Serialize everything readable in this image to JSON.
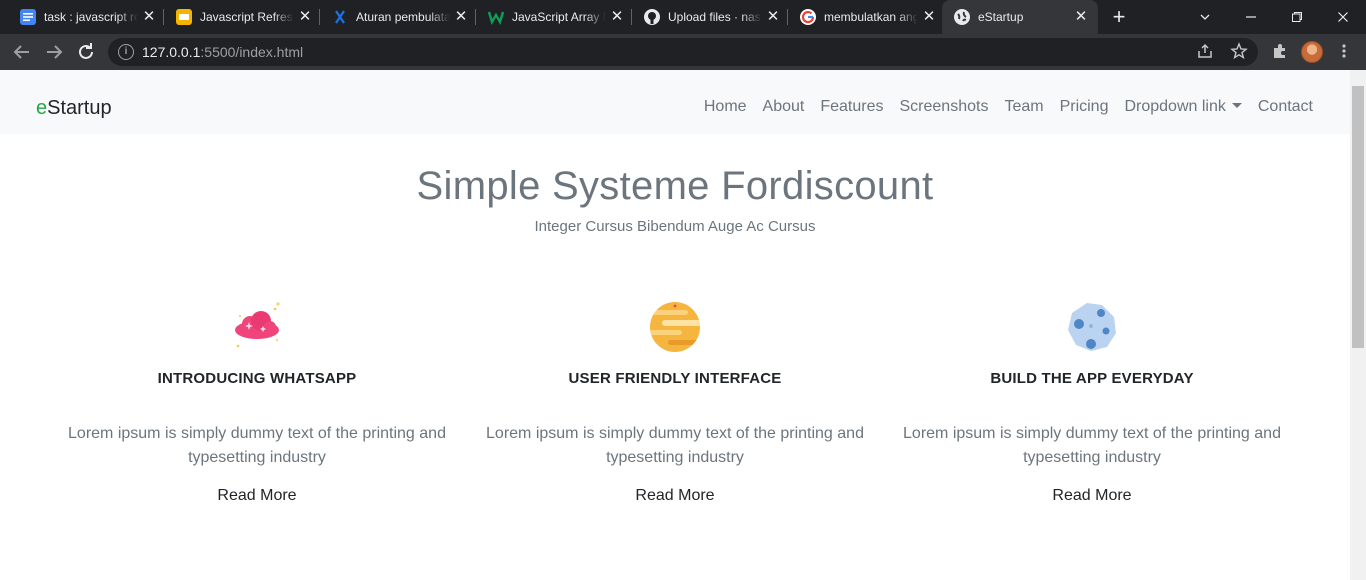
{
  "browser": {
    "tabs": [
      {
        "label": "task : javascript re",
        "favicon_color": "#4285f4",
        "active": false
      },
      {
        "label": "Javascript Refresh",
        "favicon_color": "#f4b400",
        "active": false
      },
      {
        "label": "Aturan pembulata",
        "favicon_color": "#1a73e8",
        "active": false
      },
      {
        "label": "JavaScript Array M",
        "favicon_color": "#0f9d58",
        "active": false
      },
      {
        "label": "Upload files · nas",
        "favicon_color": "#e8eaed",
        "active": false
      },
      {
        "label": "membulatkan ang",
        "favicon_color": "#ea4335",
        "active": false
      },
      {
        "label": "eStartup",
        "favicon_color": "#e8eaed",
        "active": true
      }
    ],
    "close_glyph": "✕",
    "new_tab_glyph": "+",
    "url_host": "127.0.0.1",
    "url_rest": ":5500/index.html",
    "info_glyph": "i"
  },
  "site": {
    "brand_first": "e",
    "brand_rest": "Startup",
    "nav": [
      "Home",
      "About",
      "Features",
      "Screenshots",
      "Team",
      "Pricing",
      "Dropdown link",
      "Contact"
    ],
    "hero": {
      "title": "Simple Systeme Fordiscount",
      "subtitle": "Integer Cursus Bibendum Auge Ac Cursus"
    },
    "features": [
      {
        "title": "INTRODUCING WHATSAPP",
        "desc": "Lorem ipsum is simply dummy text of the printing and typesetting industry",
        "more": "Read More",
        "icon": "pink-cloud-sparkle-icon"
      },
      {
        "title": "USER FRIENDLY INTERFACE",
        "desc": "Lorem ipsum is simply dummy text of the printing and typesetting industry",
        "more": "Read More",
        "icon": "orange-planet-icon"
      },
      {
        "title": "BUILD THE APP EVERYDAY",
        "desc": "Lorem ipsum is simply dummy text of the printing and typesetting industry",
        "more": "Read More",
        "icon": "blue-moon-icon"
      }
    ]
  },
  "colors": {
    "brand_accent": "#28a745",
    "chrome_dark": "#202124",
    "chrome_toolbar": "#35363a",
    "navbar_bg": "#f8f9fa",
    "muted_text": "#6c757d"
  }
}
